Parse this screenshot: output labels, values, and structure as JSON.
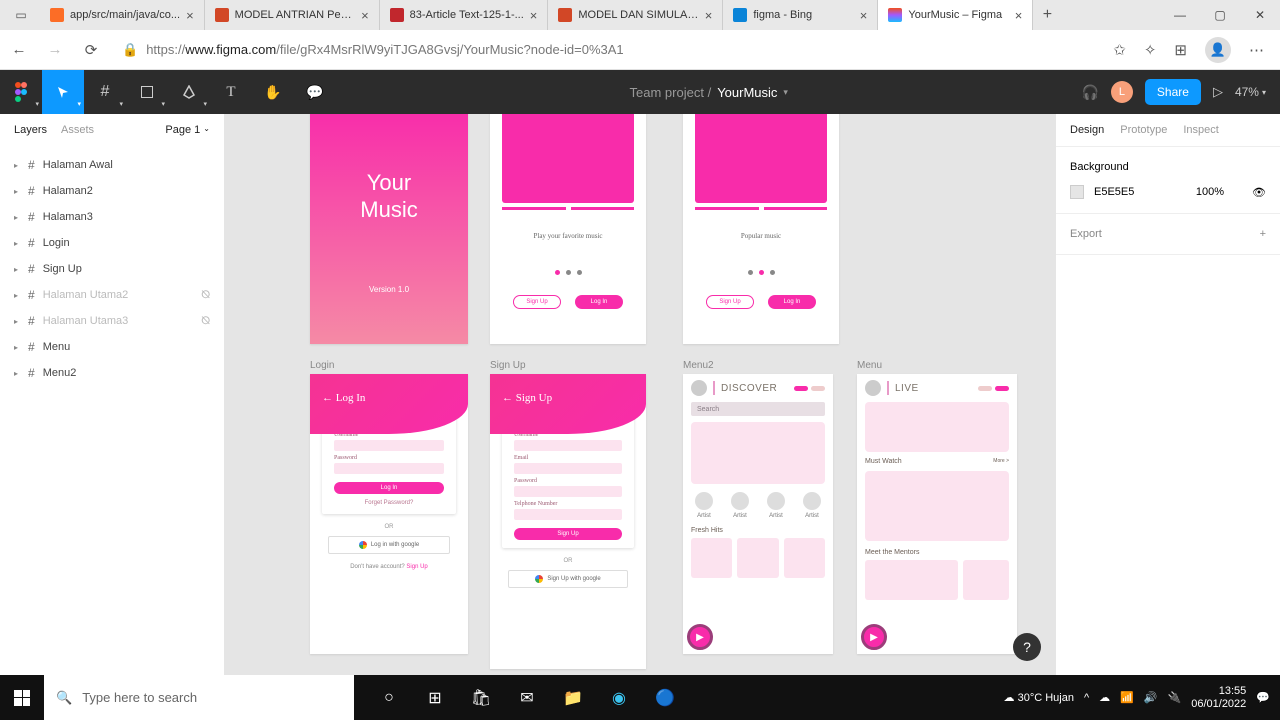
{
  "browser": {
    "tabs": [
      {
        "label": "app/src/main/java/co...",
        "favColor": "#fc6d26"
      },
      {
        "label": "MODEL ANTRIAN Pen...",
        "favColor": "#d24726"
      },
      {
        "label": "83-Article Text-125-1-...",
        "favColor": "#c1272d"
      },
      {
        "label": "MODEL DAN SIMULAS...",
        "favColor": "#d24726"
      },
      {
        "label": "figma - Bing",
        "favColor": "#0a84d8"
      },
      {
        "label": "YourMusic – Figma",
        "favColor": "#a259ff"
      }
    ],
    "url_prefix": "https://",
    "url_host": "www.figma.com",
    "url_path": "/file/gRx4MsrRlW9yiTJGA8Gvsj/YourMusic?node-id=0%3A1"
  },
  "figma": {
    "project": "Team project /",
    "file": "YourMusic",
    "share": "Share",
    "zoom": "47%",
    "avatar_initial": "L"
  },
  "left": {
    "tab_layers": "Layers",
    "tab_assets": "Assets",
    "page": "Page 1",
    "layers": [
      {
        "name": "Halaman Awal",
        "hidden": false
      },
      {
        "name": "Halaman2",
        "hidden": false
      },
      {
        "name": "Halaman3",
        "hidden": false
      },
      {
        "name": "Login",
        "hidden": false
      },
      {
        "name": "Sign Up",
        "hidden": false
      },
      {
        "name": "Halaman Utama2",
        "hidden": true
      },
      {
        "name": "Halaman Utama3",
        "hidden": true
      },
      {
        "name": "Menu",
        "hidden": false
      },
      {
        "name": "Menu2",
        "hidden": false
      }
    ]
  },
  "right": {
    "tab_design": "Design",
    "tab_prototype": "Prototype",
    "tab_inspect": "Inspect",
    "bg_title": "Background",
    "bg_hex": "E5E5E5",
    "bg_opacity": "100%",
    "export": "Export"
  },
  "artboards": {
    "splash": {
      "title_l1": "Your",
      "title_l2": "Music",
      "version": "Version 1.0"
    },
    "onb1": {
      "caption": "Play your favorite music",
      "signup": "Sign Up",
      "login": "Log In"
    },
    "onb2": {
      "caption": "Popular music",
      "signup": "Sign Up",
      "login": "Log In"
    },
    "login": {
      "label": "Login",
      "header": "← Log In",
      "f_user": "Username",
      "f_pass": "Password",
      "submit": "Log In",
      "forgot": "Forget Password?",
      "or": "OR",
      "google": "Log in with google",
      "foot_pre": "Don't have account? ",
      "foot_link": "Sign Up"
    },
    "signup": {
      "label": "Sign Up",
      "header": "← Sign Up",
      "f_user": "Username",
      "f_email": "Email",
      "f_pass": "Password",
      "f_tel": "Telphone Number",
      "submit": "Sign Up",
      "or": "OR",
      "google": "Sign Up with google"
    },
    "menu2": {
      "label": "Menu2",
      "title": "DISCOVER",
      "search": "Search",
      "artist": "Artist",
      "fresh": "Fresh Hits"
    },
    "menu": {
      "label": "Menu",
      "title": "LIVE",
      "mw": "Must Watch",
      "more": "More >",
      "mentors": "Meet the Mentors"
    }
  },
  "taskbar": {
    "search_placeholder": "Type here to search",
    "weather": "30°C  Hujan",
    "time": "13:55",
    "date": "06/01/2022"
  }
}
